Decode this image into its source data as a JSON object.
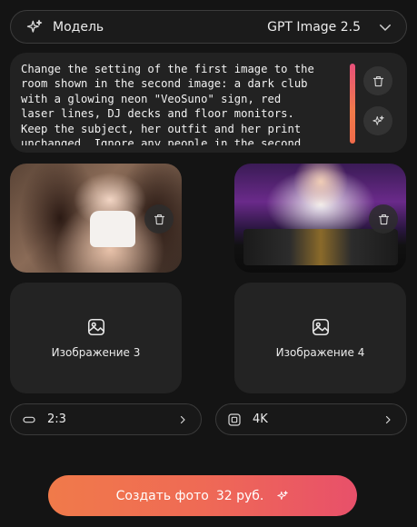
{
  "model_selector": {
    "label": "Модель",
    "value": "GPT Image 2.5",
    "icons": {
      "leading": "sparkle-icon",
      "trailing": "chevron-down-icon"
    }
  },
  "prompt": {
    "lines": [
      "Change the setting of the first image to the",
      "room shown in the second image: a dark club",
      "with a glowing neon \"VeoSuno\" sign, red",
      "laser lines, DJ decks and floor monitors.",
      "Keep the subject, her outfit and her print",
      "unchanged. Ignore any people in the second"
    ],
    "actions": [
      "trash-icon",
      "sparkle-icon"
    ]
  },
  "images": [
    {
      "slot": 1,
      "icon": "trash-icon"
    },
    {
      "slot": 2,
      "icon": "trash-icon"
    }
  ],
  "placeholders": [
    {
      "label": "Изображение 3",
      "icon": "image-icon"
    },
    {
      "label": "Изображение 4",
      "icon": "image-icon"
    }
  ],
  "options": {
    "aspect_ratio": {
      "value": "2:3",
      "icon": "aspect-ratio-icon"
    },
    "resolution": {
      "value": "4K",
      "icon": "resolution-icon"
    }
  },
  "create_button": {
    "label": "Создать фото",
    "price": "32 руб.",
    "icon": "sparkle-icon"
  },
  "colors": {
    "background": "#141414",
    "accent_start": "#f07a4a",
    "accent_end": "#e8506a"
  }
}
